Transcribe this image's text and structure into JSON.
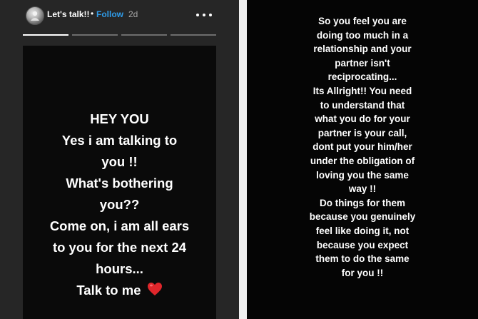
{
  "header": {
    "username": "Let's talk!!",
    "separator": "•",
    "follow_label": "Follow",
    "time_ago": "2d",
    "more_icon": "more-horizontal-icon",
    "avatar_icon": "profile-avatar"
  },
  "progress": {
    "segments": 4,
    "active_index": 0
  },
  "story_left": {
    "lines": [
      "HEY YOU",
      "Yes i am talking to",
      "you !!",
      "What's bothering",
      "you??",
      "Come on, i am all ears",
      "to you for the next 24",
      "hours...",
      "Talk to me"
    ],
    "emoji": "❤️",
    "emoji_color": "#e0262b"
  },
  "story_right": {
    "lines": [
      "So you feel you are",
      "doing too much in a",
      "relationship and your",
      "partner isn't",
      "reciprocating...",
      "Its Allright!! You need",
      "to understand that",
      "what you do for your",
      "partner is your call,",
      "dont put your him/her",
      "under the obligation of",
      "loving you the same",
      "way !!",
      "Do things for them",
      "because you genuinely",
      "feel like doing it, not",
      "because you expect",
      "them to do the same",
      "for you !!"
    ]
  },
  "colors": {
    "follow": "#2f9be8",
    "panel_bg": "#262626",
    "story_bg": "#0a0a0a"
  }
}
